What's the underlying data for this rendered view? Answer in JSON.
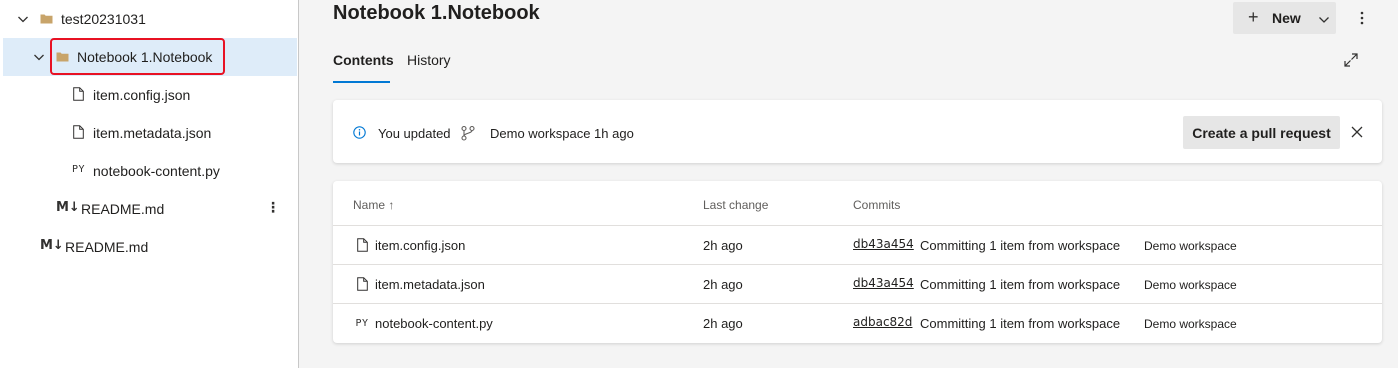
{
  "tree": {
    "items": [
      {
        "label": "test20231031",
        "icon": "folder-icon",
        "expanded": true
      },
      {
        "label": "Notebook 1.Notebook",
        "icon": "folder-icon",
        "expanded": true,
        "selected": true
      },
      {
        "label": "item.config.json",
        "icon": "file-icon"
      },
      {
        "label": "item.metadata.json",
        "icon": "file-icon"
      },
      {
        "label": "notebook-content.py",
        "icon": "py-icon",
        "icon_text": "PY"
      },
      {
        "label": "README.md",
        "icon": "markdown-icon",
        "icon_text": "M↓"
      },
      {
        "label": "README.md",
        "icon": "markdown-icon",
        "icon_text": "M↓"
      }
    ]
  },
  "header": {
    "title": "Notebook 1.Notebook",
    "new_label": "New"
  },
  "tabs": [
    {
      "label": "Contents",
      "active": true
    },
    {
      "label": "History",
      "active": false
    }
  ],
  "banner": {
    "message": "You updated",
    "workspace_text": "Demo workspace 1h ago",
    "pr_label": "Create a pull request"
  },
  "table": {
    "headers": {
      "name": "Name ↑",
      "last_change": "Last change",
      "commits": "Commits"
    },
    "rows": [
      {
        "icon": "file-icon",
        "icon_text": "",
        "name": "item.config.json",
        "time": "2h ago",
        "hash": "db43a454",
        "message": "Committing 1 item from workspace",
        "workspace": "Demo workspace"
      },
      {
        "icon": "file-icon",
        "icon_text": "",
        "name": "item.metadata.json",
        "time": "2h ago",
        "hash": "db43a454",
        "message": "Committing 1 item from workspace",
        "workspace": "Demo workspace"
      },
      {
        "icon": "py-icon",
        "icon_text": "PY",
        "name": "notebook-content.py",
        "time": "2h ago",
        "hash": "adbac82d",
        "message": "Committing 1 item from workspace",
        "workspace": "Demo workspace"
      }
    ]
  },
  "colors": {
    "accent": "#0078d4",
    "selected_bg": "#deecf9",
    "highlight": "#e81123",
    "folder": "#c8a46a"
  }
}
